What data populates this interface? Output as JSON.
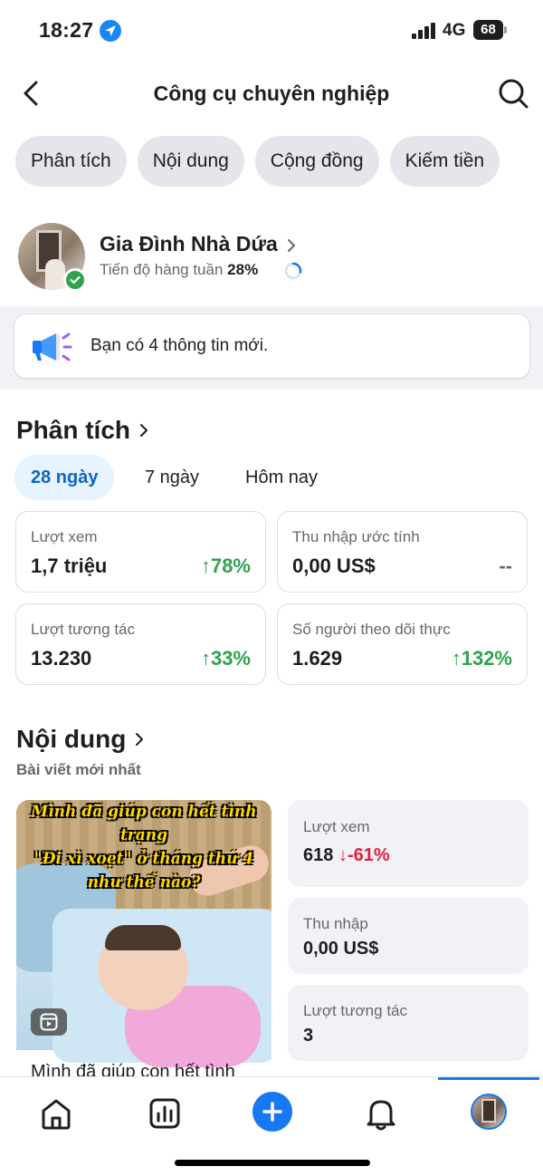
{
  "status_bar": {
    "time": "18:27",
    "network": "4G",
    "battery": "68"
  },
  "header": {
    "title": "Công cụ chuyên nghiệp"
  },
  "tabs": [
    {
      "label": "Phân tích"
    },
    {
      "label": "Nội dung"
    },
    {
      "label": "Cộng đồng"
    },
    {
      "label": "Kiếm tiền"
    }
  ],
  "profile": {
    "name": "Gia Đình Nhà Dứa",
    "progress_label": "Tiến độ hàng tuần",
    "progress_percent": "28%",
    "progress_value": 0.28
  },
  "notice": {
    "text": "Bạn có 4 thông tin mới."
  },
  "analytics": {
    "title": "Phân tích",
    "periods": [
      {
        "label": "28 ngày",
        "active": true
      },
      {
        "label": "7 ngày",
        "active": false
      },
      {
        "label": "Hôm nay",
        "active": false
      }
    ],
    "cards": [
      {
        "label": "Lượt xem",
        "value": "1,7 triệu",
        "change": "↑78%"
      },
      {
        "label": "Thu nhập ước tính",
        "value": "0,00 US$",
        "change": "--"
      },
      {
        "label": "Lượt tương tác",
        "value": "13.230",
        "change": "↑33%"
      },
      {
        "label": "Số người theo dõi thực",
        "value": "1.629",
        "change": "↑132%"
      }
    ]
  },
  "content": {
    "title": "Nội dung",
    "subtitle": "Bài viết mới nhất",
    "post": {
      "thumbnail_caption": "Mình đã giúp con hết tình trạng\n\"Đi xì xoẹt\" ở tháng thứ 4\nnhư thế nào?",
      "title": "Mình đã giúp con hết tình"
    },
    "stats": [
      {
        "label": "Lượt xem",
        "value": "618",
        "change": "↓-61%"
      },
      {
        "label": "Thu nhập",
        "value": "0,00 US$"
      },
      {
        "label": "Lượt tương tác",
        "value": "3"
      }
    ]
  },
  "icons": {
    "back": "chevron-left-icon",
    "search": "search-icon",
    "megaphone": "megaphone-icon",
    "reel": "reel-icon",
    "nav": [
      "home-icon",
      "insights-icon",
      "create-icon",
      "notifications-icon",
      "profile-avatar"
    ]
  },
  "colors": {
    "accent": "#1877f2",
    "positive": "#31a24c",
    "negative": "#e41e3f"
  }
}
